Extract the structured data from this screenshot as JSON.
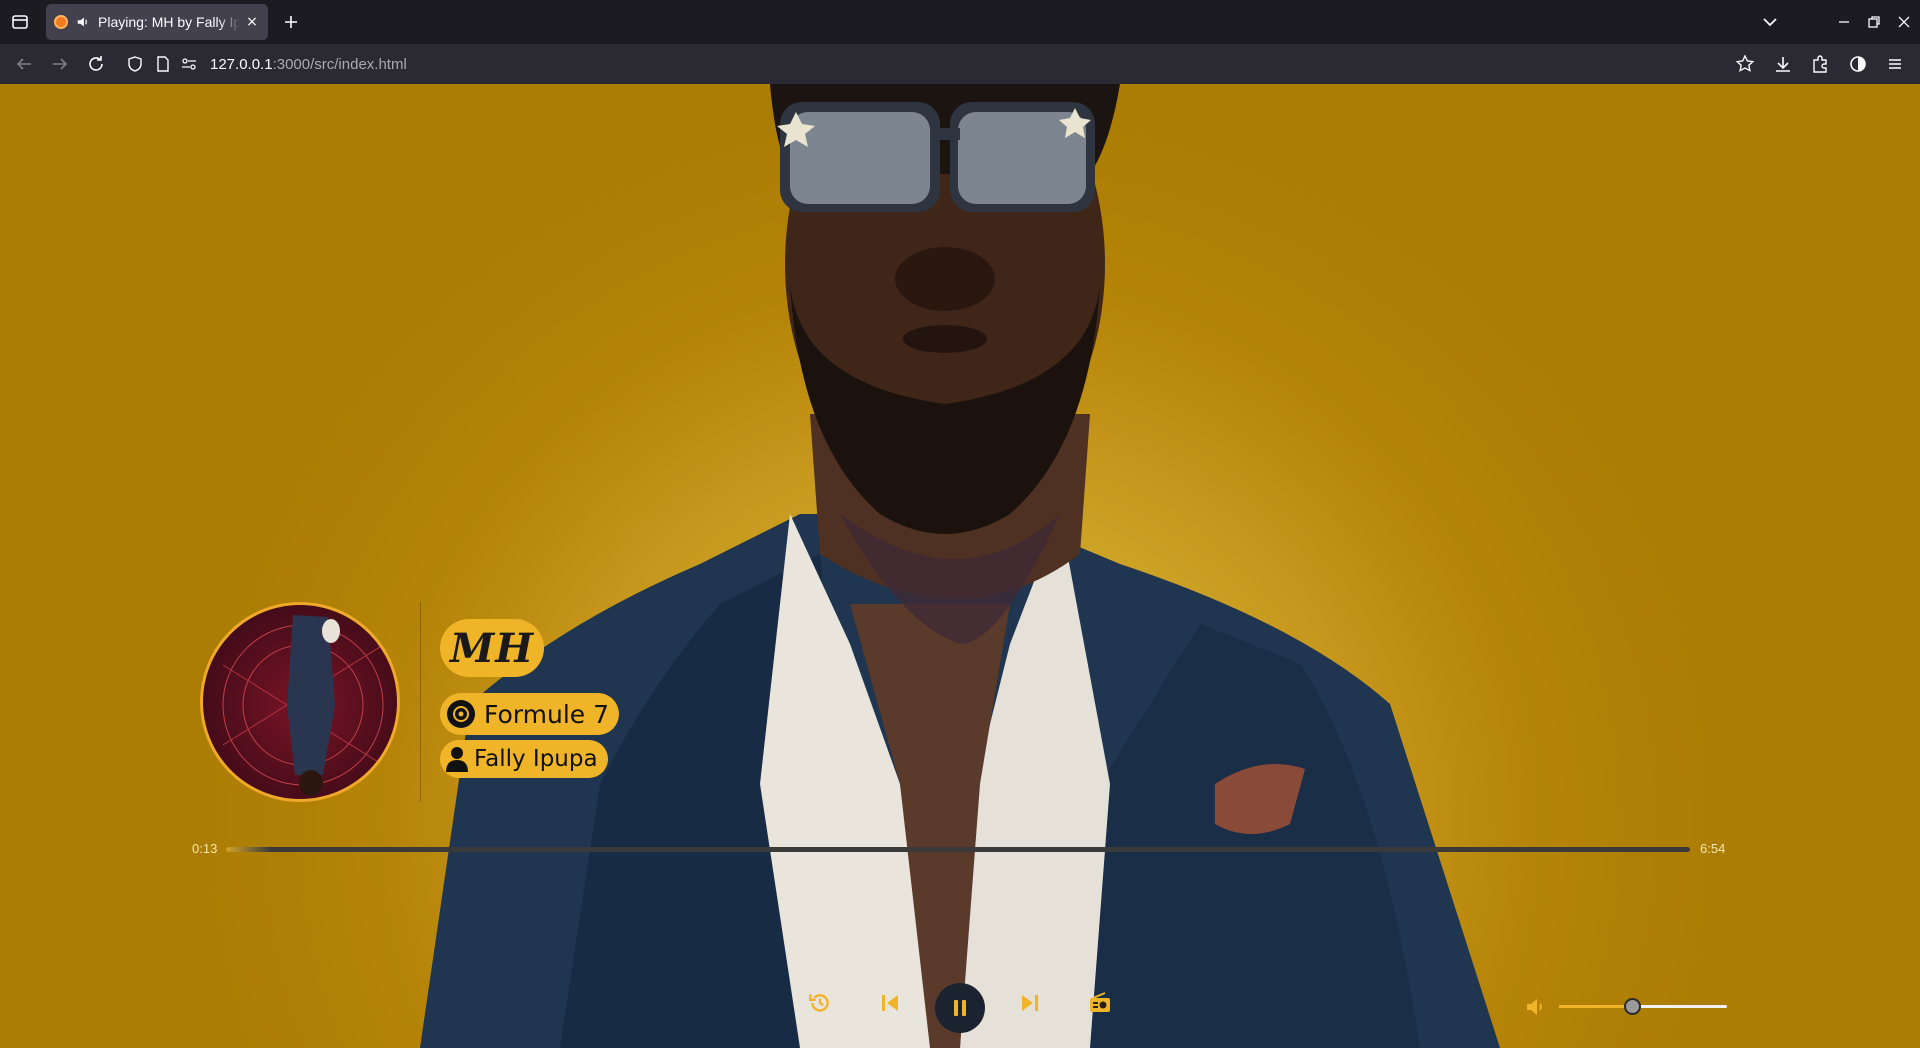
{
  "browser": {
    "tab_title": "Playing: MH by Fally Ipupa",
    "tab_close": "×",
    "url_host": "127.0.0.1",
    "url_path": ":3000/src/index.html"
  },
  "player": {
    "song_title": "MH",
    "album": "Formule 7",
    "artist": "Fally Ipupa",
    "current_time": "0:13",
    "duration": "6:54",
    "progress_fraction": 0.031,
    "volume_fraction": 0.44,
    "is_playing": true
  },
  "colors": {
    "accent": "#f0b429",
    "play_button_bg": "#1b2230",
    "background": "#c5961b"
  },
  "icons": {
    "controls": [
      "history-icon",
      "previous-icon",
      "pause-icon",
      "next-icon",
      "radio-icon"
    ],
    "album": "disc-icon",
    "artist": "user-icon",
    "volume": "volume-low-icon"
  }
}
